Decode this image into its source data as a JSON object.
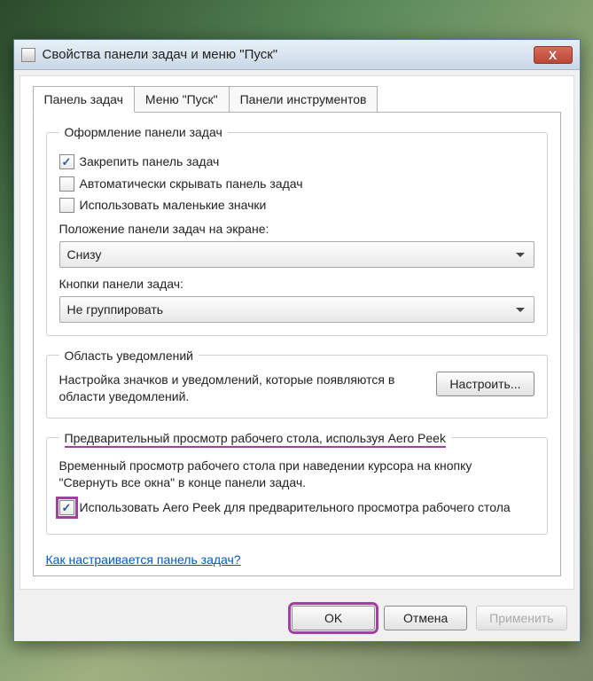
{
  "titlebar": {
    "title": "Свойства панели задач и меню \"Пуск\"",
    "close": "X"
  },
  "tabs": {
    "t0": "Панель задач",
    "t1": "Меню \"Пуск\"",
    "t2": "Панели инструментов"
  },
  "appearance": {
    "legend": "Оформление панели задач",
    "lock": "Закрепить панель задач",
    "autohide": "Автоматически скрывать панель задач",
    "smallicons": "Использовать маленькие значки",
    "position_label": "Положение панели задач на экране:",
    "position_value": "Снизу",
    "buttons_label": "Кнопки панели задач:",
    "buttons_value": "Не группировать"
  },
  "notifications": {
    "legend": "Область уведомлений",
    "desc": "Настройка значков и уведомлений, которые появляются в области уведомлений.",
    "customize": "Настроить..."
  },
  "aero": {
    "legend": "Предварительный просмотр рабочего стола, используя Aero Peek",
    "desc": "Временный просмотр рабочего стола при наведении курсора на кнопку \"Свернуть все окна\" в конце панели задач.",
    "use": "Использовать Aero Peek для предварительного просмотра рабочего стола"
  },
  "link": "Как настраивается панель задач?",
  "footer": {
    "ok": "OK",
    "cancel": "Отмена",
    "apply": "Применить"
  }
}
